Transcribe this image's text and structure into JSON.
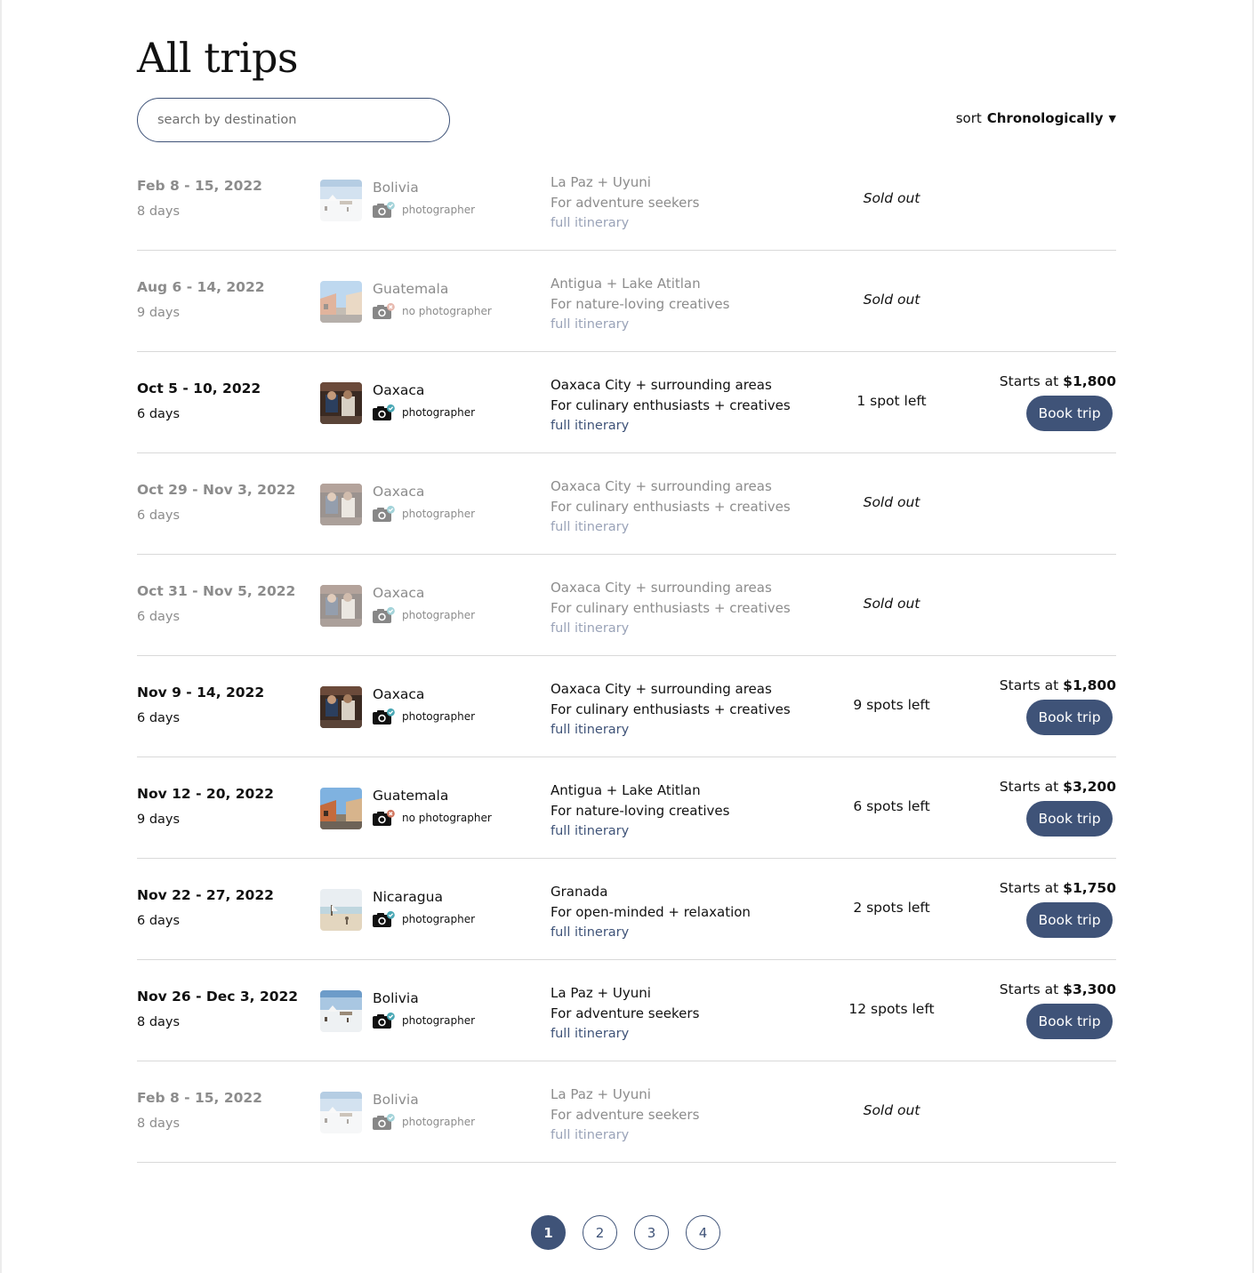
{
  "page": {
    "title": "All trips"
  },
  "search": {
    "placeholder": "search by destination"
  },
  "sort": {
    "prefix": "sort",
    "value": "Chronologically"
  },
  "colors": {
    "accent": "#3f5378",
    "divider": "#d9d9d9",
    "photographer_check": "#4aa8b5",
    "no_photographer_x": "#d1765f"
  },
  "trips": [
    {
      "dates": "Feb 8 - 15, 2022",
      "days": "8 days",
      "image": "bolivia-salt-flat-photo",
      "destination": "Bolivia",
      "photographer_icon": "camera-check-icon",
      "photographer_label": "photographer",
      "places": "La Paz + Uyuni",
      "audience": "For adventure seekers",
      "itinerary_link": "full itinerary",
      "status": "Sold out",
      "sold_out": true,
      "price_prefix": "",
      "price": "",
      "book_label": ""
    },
    {
      "dates": "Aug 6 - 14, 2022",
      "days": "9 days",
      "image": "guatemala-street-photo",
      "destination": "Guatemala",
      "photographer_icon": "camera-x-icon",
      "photographer_label": "no photographer",
      "places": "Antigua + Lake Atitlan",
      "audience": "For nature-loving creatives",
      "itinerary_link": "full itinerary",
      "status": "Sold out",
      "sold_out": true,
      "price_prefix": "",
      "price": "",
      "book_label": ""
    },
    {
      "dates": "Oct 5 - 10, 2022",
      "days": "6 days",
      "image": "oaxaca-travelers-photo",
      "destination": "Oaxaca",
      "photographer_icon": "camera-check-icon",
      "photographer_label": "photographer",
      "places": "Oaxaca City + surrounding areas",
      "audience": "For culinary enthusiasts + creatives",
      "itinerary_link": "full itinerary",
      "status": "1 spot left",
      "sold_out": false,
      "price_prefix": "Starts at",
      "price": "$1,800",
      "book_label": "Book trip"
    },
    {
      "dates": "Oct 29 - Nov 3, 2022",
      "days": "6 days",
      "image": "oaxaca-travelers-photo",
      "destination": "Oaxaca",
      "photographer_icon": "camera-check-icon",
      "photographer_label": "photographer",
      "places": "Oaxaca City + surrounding areas",
      "audience": "For culinary enthusiasts + creatives",
      "itinerary_link": "full itinerary",
      "status": "Sold out",
      "sold_out": true,
      "price_prefix": "",
      "price": "",
      "book_label": ""
    },
    {
      "dates": "Oct 31 - Nov 5, 2022",
      "days": "6 days",
      "image": "oaxaca-travelers-photo",
      "destination": "Oaxaca",
      "photographer_icon": "camera-check-icon",
      "photographer_label": "photographer",
      "places": "Oaxaca City + surrounding areas",
      "audience": "For culinary enthusiasts + creatives",
      "itinerary_link": "full itinerary",
      "status": "Sold out",
      "sold_out": true,
      "price_prefix": "",
      "price": "",
      "book_label": ""
    },
    {
      "dates": "Nov 9 - 14, 2022",
      "days": "6 days",
      "image": "oaxaca-travelers-photo",
      "destination": "Oaxaca",
      "photographer_icon": "camera-check-icon",
      "photographer_label": "photographer",
      "places": "Oaxaca City + surrounding areas",
      "audience": "For culinary enthusiasts + creatives",
      "itinerary_link": "full itinerary",
      "status": "9 spots left",
      "sold_out": false,
      "price_prefix": "Starts at",
      "price": "$1,800",
      "book_label": "Book trip"
    },
    {
      "dates": "Nov 12 - 20, 2022",
      "days": "9 days",
      "image": "guatemala-street-photo",
      "destination": "Guatemala",
      "photographer_icon": "camera-x-icon",
      "photographer_label": "no photographer",
      "places": "Antigua + Lake Atitlan",
      "audience": "For nature-loving creatives",
      "itinerary_link": "full itinerary",
      "status": "6 spots left",
      "sold_out": false,
      "price_prefix": "Starts at",
      "price": "$3,200",
      "book_label": "Book trip"
    },
    {
      "dates": "Nov 22 - 27, 2022",
      "days": "6 days",
      "image": "nicaragua-beach-photo",
      "destination": "Nicaragua",
      "photographer_icon": "camera-check-icon",
      "photographer_label": "photographer",
      "places": "Granada",
      "audience": "For open-minded + relaxation",
      "itinerary_link": "full itinerary",
      "status": "2 spots left",
      "sold_out": false,
      "price_prefix": "Starts at",
      "price": "$1,750",
      "book_label": "Book trip"
    },
    {
      "dates": "Nov 26 - Dec 3, 2022",
      "days": "8 days",
      "image": "bolivia-salt-flat-photo",
      "destination": "Bolivia",
      "photographer_icon": "camera-check-icon",
      "photographer_label": "photographer",
      "places": "La Paz + Uyuni",
      "audience": "For adventure seekers",
      "itinerary_link": "full itinerary",
      "status": "12 spots left",
      "sold_out": false,
      "price_prefix": "Starts at",
      "price": "$3,300",
      "book_label": "Book trip"
    },
    {
      "dates": "Feb 8 - 15, 2022",
      "days": "8 days",
      "image": "bolivia-salt-flat-photo",
      "destination": "Bolivia",
      "photographer_icon": "camera-check-icon",
      "photographer_label": "photographer",
      "places": "La Paz + Uyuni",
      "audience": "For adventure seekers",
      "itinerary_link": "full itinerary",
      "status": "Sold out",
      "sold_out": true,
      "price_prefix": "",
      "price": "",
      "book_label": ""
    }
  ],
  "pagination": {
    "pages": [
      "1",
      "2",
      "3",
      "4"
    ],
    "current": "1"
  }
}
